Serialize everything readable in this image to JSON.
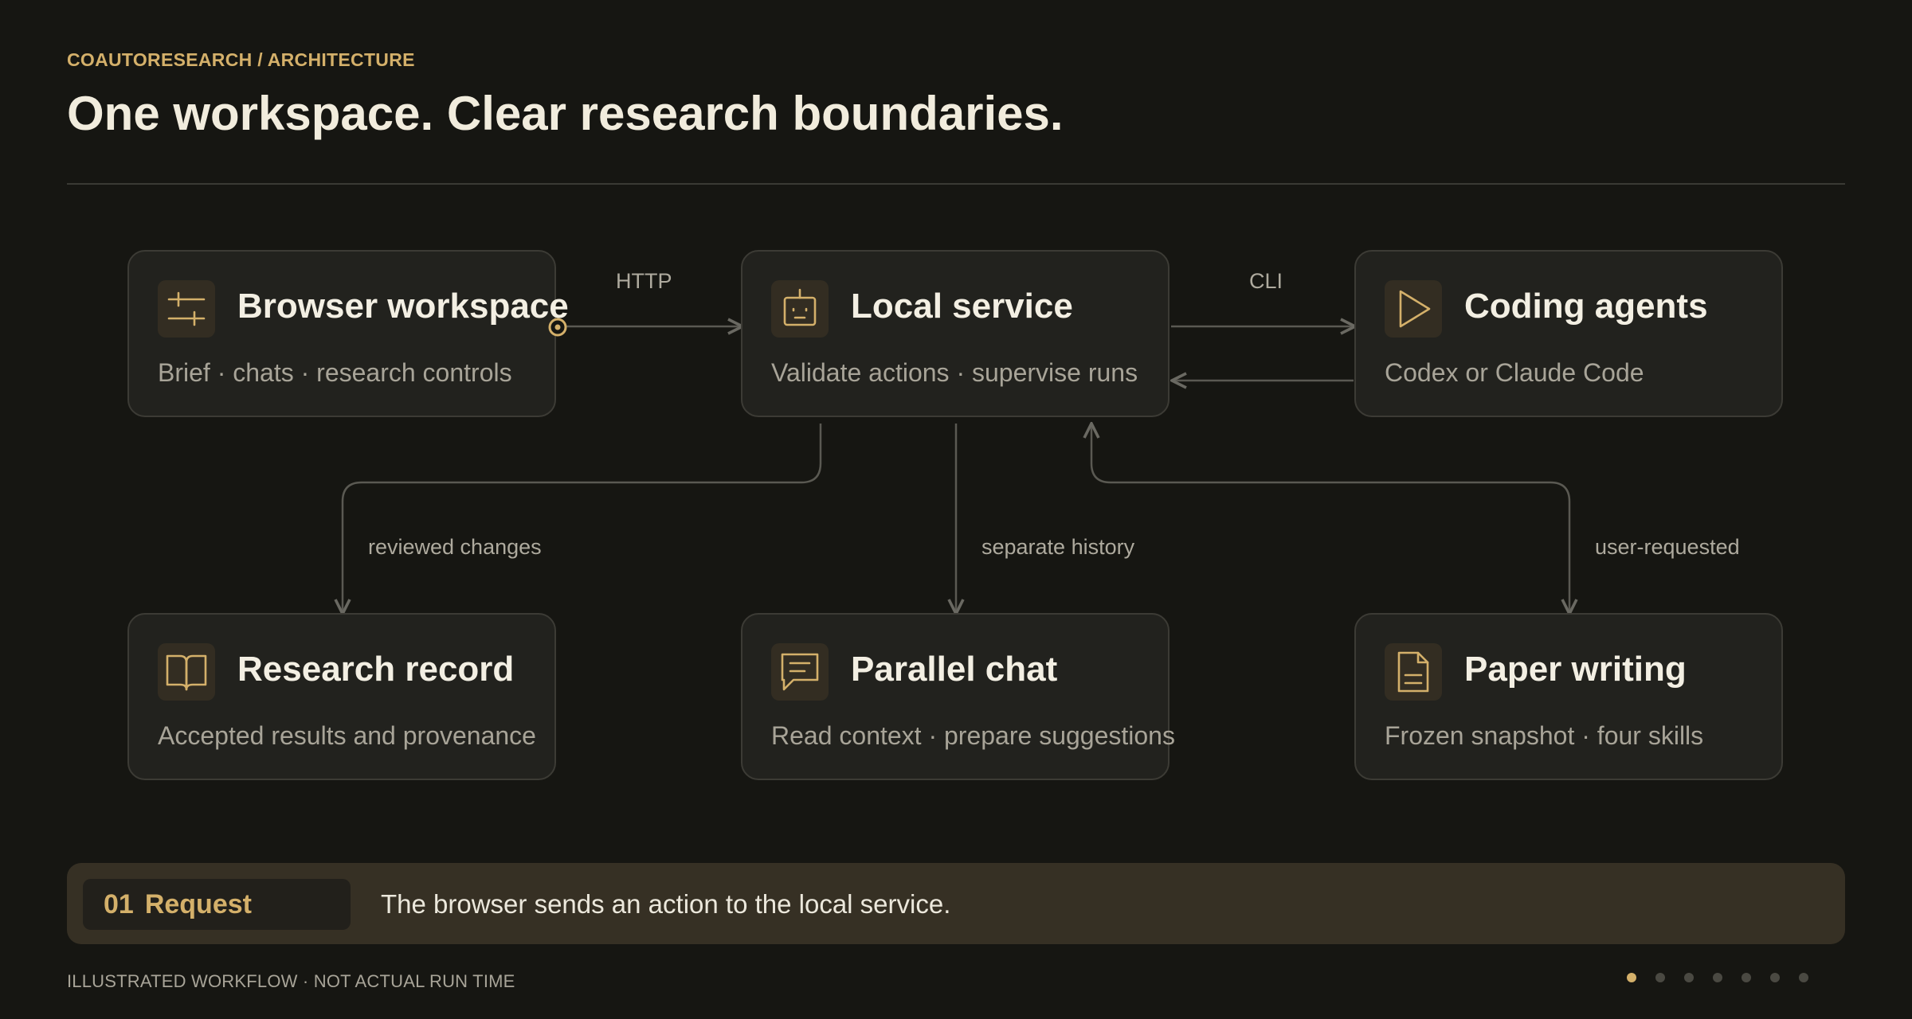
{
  "header": {
    "eyebrow": "COAUTORESEARCH / ARCHITECTURE",
    "title": "One workspace. Clear research boundaries."
  },
  "nodes": {
    "browser": {
      "name": "Browser workspace",
      "desc": "Brief · chats · research controls",
      "icon": "sliders-icon"
    },
    "local": {
      "name": "Local service",
      "desc": "Validate actions · supervise runs",
      "icon": "robot-icon"
    },
    "agents": {
      "name": "Coding agents",
      "desc": "Codex or Claude Code",
      "icon": "play-icon"
    },
    "record": {
      "name": "Research record",
      "desc": "Accepted results and provenance",
      "icon": "book-icon"
    },
    "chat": {
      "name": "Parallel chat",
      "desc": "Read context · prepare suggestions",
      "icon": "chat-bubble-icon"
    },
    "paper": {
      "name": "Paper writing",
      "desc": "Frozen snapshot · four skills",
      "icon": "document-icon"
    }
  },
  "edges": {
    "http": "HTTP",
    "cli": "CLI",
    "reviewed": "reviewed changes",
    "history": "separate history",
    "requested": "user-requested"
  },
  "step": {
    "number": "01",
    "label": "Request",
    "text": "The browser sends an action to the local service."
  },
  "footer": {
    "note": "ILLUSTRATED WORKFLOW · NOT ACTUAL RUN TIME",
    "total_steps": 7,
    "active_step": 1
  },
  "colors": {
    "background": "#161612",
    "accent": "#d4b06a",
    "card": "#22221e",
    "connector": "#5a5952"
  }
}
